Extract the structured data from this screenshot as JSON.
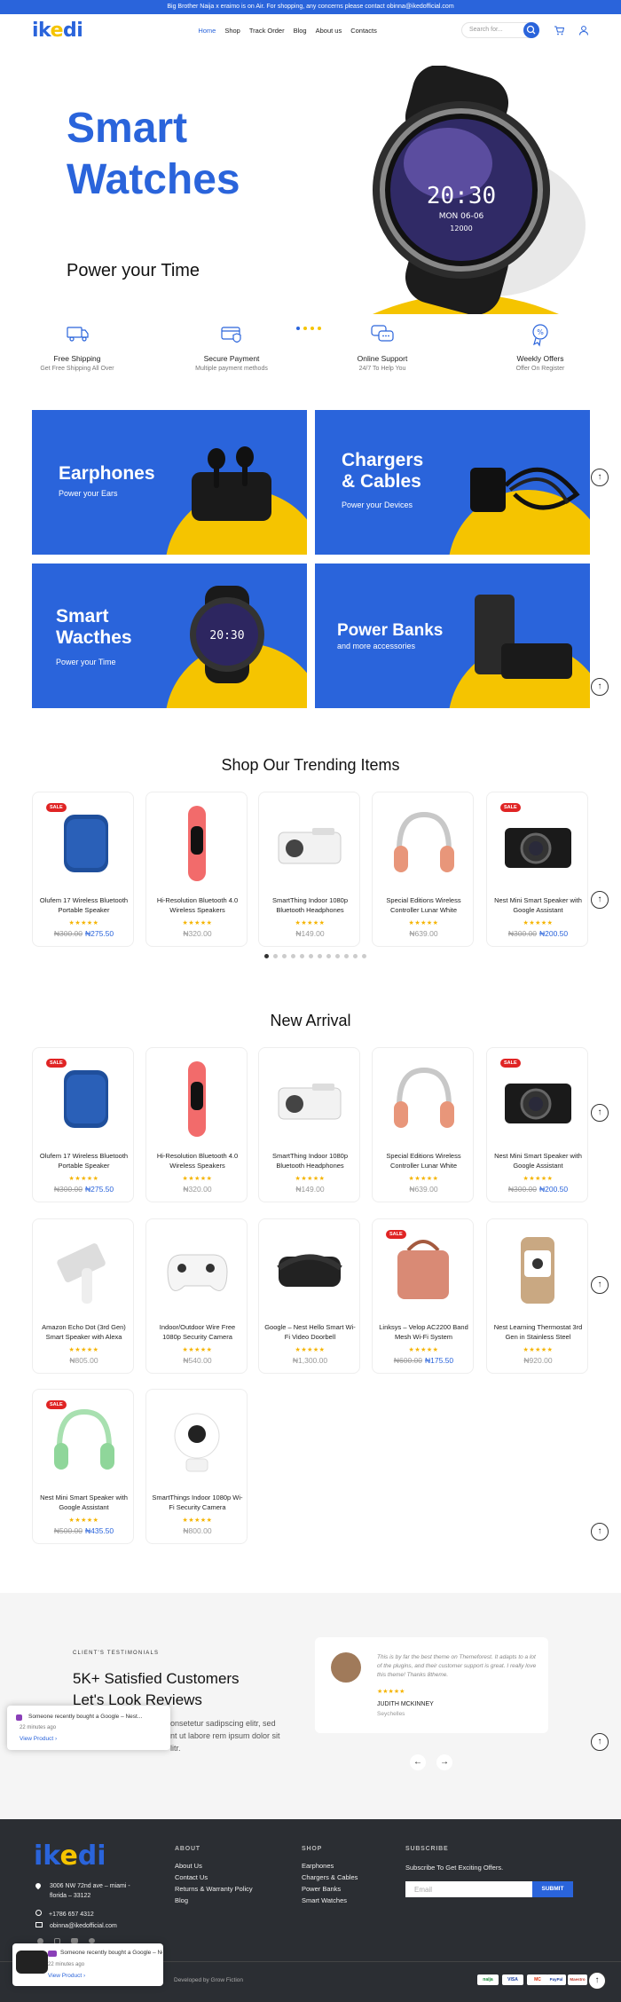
{
  "topbar": {
    "text": "Big Brother Naija x eraimo is on Air. For shopping, any concerns please contact obinna@ikedofficial.com"
  },
  "header": {
    "logo": "ikedi",
    "nav": [
      "Home",
      "Shop",
      "Track Order",
      "Blog",
      "About us",
      "Contacts"
    ],
    "search_placeholder": "Search for..."
  },
  "hero": {
    "title_line1": "Smart",
    "title_line2": "Watches",
    "subtitle": "Power your Time",
    "watch_time": "20:30",
    "watch_date": "MON 06-06",
    "watch_steps": "12000"
  },
  "features": [
    {
      "icon": "free-shipping-icon",
      "title": "Free Shipping",
      "sub": "Get Free Shipping All Over"
    },
    {
      "icon": "secure-payment-icon",
      "title": "Secure Payment",
      "sub": "Multiple payment methods"
    },
    {
      "icon": "online-support-icon",
      "title": "Online Support",
      "sub": "24/7 To Help You"
    },
    {
      "icon": "weekly-offers-icon",
      "title": "Weekly Offers",
      "sub": "Offer On Register"
    }
  ],
  "banners": [
    {
      "title": "Earphones",
      "sub": "Power your Ears"
    },
    {
      "title_l1": "Chargers",
      "title_l2": "& Cables",
      "sub": "Power your Devices"
    },
    {
      "title_l1": "Smart",
      "title_l2": "Wacthes",
      "sub": "Power your Time"
    },
    {
      "title": "Power Banks",
      "sub": "and more accessories"
    }
  ],
  "trending": {
    "title": "Shop Our Trending Items",
    "items": [
      {
        "name": "Olufem 17 Wireless Bluetooth Portable Speaker",
        "old": "₦300.00",
        "new": "₦275.50",
        "sale": "SALE"
      },
      {
        "name": "Hi-Resolution Bluetooth 4.0 Wireless Speakers",
        "price": "₦320.00"
      },
      {
        "name": "SmartThing Indoor 1080p Bluetooth Headphones",
        "price": "₦149.00"
      },
      {
        "name": "Special Editions Wireless Controller Lunar White",
        "price": "₦639.00"
      },
      {
        "name": "Nest Mini Smart Speaker with Google Assistant",
        "old": "₦300.00",
        "new": "₦200.50",
        "sale": "SALE"
      }
    ]
  },
  "arrivals": {
    "title": "New Arrival",
    "items": [
      {
        "name": "Olufem 17 Wireless Bluetooth Portable Speaker",
        "old": "₦300.00",
        "new": "₦275.50",
        "sale": "SALE"
      },
      {
        "name": "Hi-Resolution Bluetooth 4.0 Wireless Speakers",
        "price": "₦320.00"
      },
      {
        "name": "SmartThing Indoor 1080p Bluetooth Headphones",
        "price": "₦149.00"
      },
      {
        "name": "Special Editions Wireless Controller Lunar White",
        "price": "₦639.00"
      },
      {
        "name": "Nest Mini Smart Speaker with Google Assistant",
        "old": "₦300.00",
        "new": "₦200.50",
        "sale": "SALE"
      },
      {
        "name": "Amazon Echo Dot (3rd Gen) Smart Speaker with Alexa",
        "price": "₦805.00"
      },
      {
        "name": "Indoor/Outdoor Wire Free 1080p Security Camera",
        "price": "₦540.00"
      },
      {
        "name": "Google – Nest Hello Smart Wi-Fi Video Doorbell",
        "price": "₦1,300.00"
      },
      {
        "name": "Linksys – Velop AC2200 Band Mesh Wi-Fi System",
        "old": "₦600.00",
        "new": "₦175.50",
        "sale": "SALE"
      },
      {
        "name": "Nest Learning Thermostat 3rd Gen in Stainless Steel",
        "price": "₦920.00"
      },
      {
        "name": "Nest Mini Smart Speaker with Google Assistant",
        "old": "₦500.00",
        "new": "₦435.50",
        "sale": "SALE"
      },
      {
        "name": "SmartThings Indoor 1080p Wi-Fi Security Camera",
        "price": "₦800.00"
      }
    ]
  },
  "stars": "★★★★★",
  "testimonials": {
    "kicker": "CLIENT'S TESTIMONIALS",
    "heading_l1": "5K+ Satisfied Customers",
    "heading_l2": "Let's Look Reviews",
    "body_l1": "onsetetur sadipscing elitr, sed",
    "body_l2": "nt ut labore rem ipsum dolor sit",
    "body_l3": "litr.",
    "quote": "This is by far the best theme on Themeforest. It adapts to a lot of the plugins, and their customer support is great. I really love this theme! Thanks 8theme.",
    "reviewer": "JUDITH MCKINNEY",
    "location": "Seychelles"
  },
  "toast": {
    "text": "Someone recently bought a Google – Nest...",
    "time": "22 minutes ago",
    "link": "View Product ›"
  },
  "footer": {
    "logo": "ikedi",
    "address": "3006 NW 72nd ave – miami - florida – 33122",
    "phone": "+1786 657 4312",
    "email": "obinna@ikedofficial.com",
    "about_title": "ABOUT",
    "about_links": [
      "About Us",
      "Contact Us",
      "Returns & Warranty Policy",
      "Blog"
    ],
    "shop_title": "SHOP",
    "shop_links": [
      "Earphones",
      "Chargers & Cables",
      "Power Banks",
      "Smart Watches"
    ],
    "subscribe_title": "SUBSCRIBE",
    "subscribe_text": "Subscribe To Get Exciting Offers.",
    "email_placeholder": "Email",
    "submit": "SUBMIT",
    "credit": "Developed by Grow Fiction",
    "payments": [
      "naija",
      "VISA",
      "MC",
      "PayPal",
      "Maestro"
    ]
  }
}
